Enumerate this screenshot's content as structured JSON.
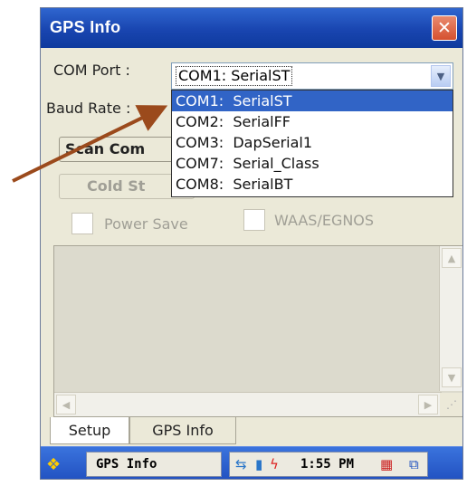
{
  "window": {
    "title": "GPS Info",
    "close_glyph": "✕"
  },
  "form": {
    "com_port_label": "COM Port :",
    "baud_rate_label": "Baud Rate :",
    "com_port_value": "COM1:  SerialST",
    "scan_button_label": "Scan Com",
    "cold_start_button_label": "Cold St",
    "power_save_label": "Power Save",
    "waas_label": "WAAS/EGNOS"
  },
  "dropdown": {
    "items": [
      "COM1:  SerialST",
      "COM2:  SerialFF",
      "COM3:  DapSerial1",
      "COM7:  Serial_Class",
      "COM8:  SerialBT"
    ],
    "selected_index": 0
  },
  "tabs": [
    "Setup",
    "GPS Info"
  ],
  "taskbar": {
    "window_button": "GPS Info",
    "time": "1:55 PM"
  },
  "icons": {
    "start": "windows-flag-icon",
    "combo_arrow": "chevron-down-icon",
    "tray": [
      "network-icon",
      "battery-icon",
      "power-icon",
      "keyboard-icon",
      "windows-icon"
    ]
  },
  "colors": {
    "title_bar": "#1945b0",
    "selection": "#3164c6",
    "close_button": "#d5502f",
    "annotation_arrow": "#9b4a1c"
  }
}
